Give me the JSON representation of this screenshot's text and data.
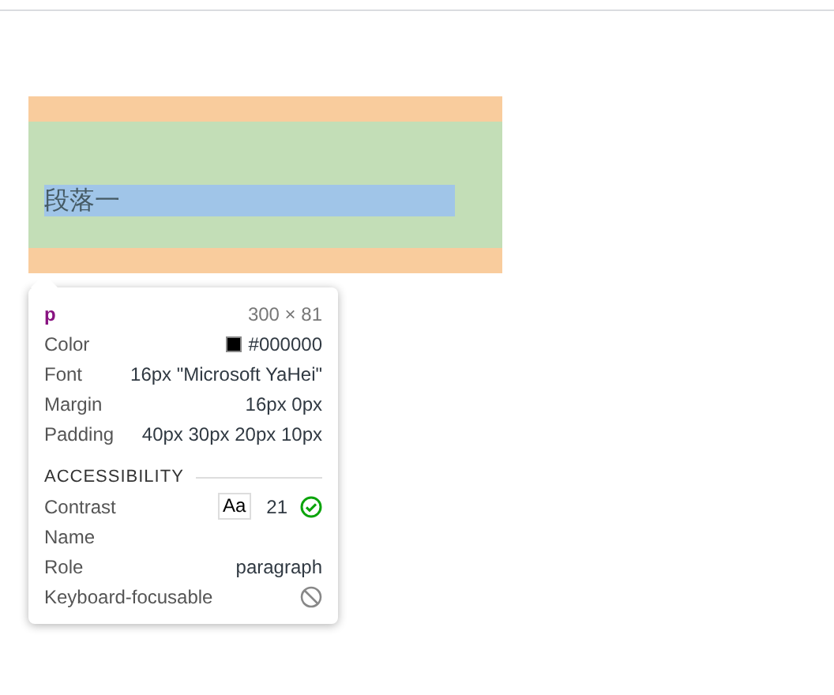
{
  "page": {
    "paragraph": "段落一"
  },
  "tooltip": {
    "tag": "p",
    "size": "300 × 81",
    "properties": [
      {
        "kind": "color",
        "label": "Color",
        "value": "#000000"
      },
      {
        "kind": "text",
        "label": "Font",
        "value": "16px \"Microsoft YaHei\""
      },
      {
        "kind": "text",
        "label": "Margin",
        "value": "16px 0px"
      },
      {
        "kind": "text",
        "label": "Padding",
        "value": "40px 30px 20px 10px"
      }
    ],
    "accessibility": {
      "heading": "ACCESSIBILITY",
      "rows": [
        {
          "kind": "contrast",
          "label": "Contrast",
          "badge": "Aa",
          "value": "21",
          "passes": true
        },
        {
          "kind": "text",
          "label": "Name"
        },
        {
          "kind": "text",
          "label": "Role",
          "value": "paragraph"
        },
        {
          "kind": "focusable",
          "label": "Keyboard-focusable",
          "focusable": false
        }
      ]
    }
  }
}
